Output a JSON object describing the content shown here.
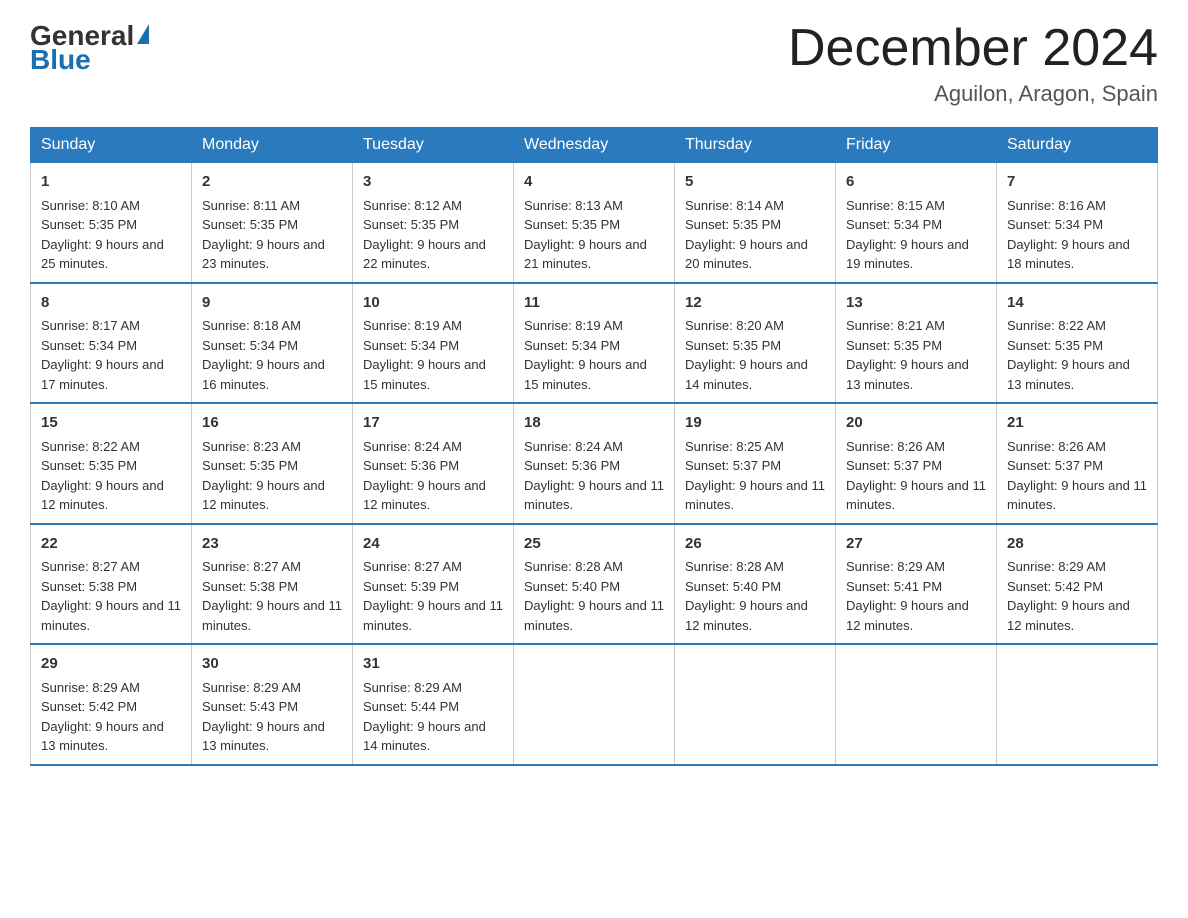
{
  "header": {
    "logo_general": "General",
    "logo_blue": "Blue",
    "month_title": "December 2024",
    "location": "Aguilon, Aragon, Spain"
  },
  "weekdays": [
    "Sunday",
    "Monday",
    "Tuesday",
    "Wednesday",
    "Thursday",
    "Friday",
    "Saturday"
  ],
  "weeks": [
    [
      {
        "day": "1",
        "sunrise": "8:10 AM",
        "sunset": "5:35 PM",
        "daylight": "9 hours and 25 minutes."
      },
      {
        "day": "2",
        "sunrise": "8:11 AM",
        "sunset": "5:35 PM",
        "daylight": "9 hours and 23 minutes."
      },
      {
        "day": "3",
        "sunrise": "8:12 AM",
        "sunset": "5:35 PM",
        "daylight": "9 hours and 22 minutes."
      },
      {
        "day": "4",
        "sunrise": "8:13 AM",
        "sunset": "5:35 PM",
        "daylight": "9 hours and 21 minutes."
      },
      {
        "day": "5",
        "sunrise": "8:14 AM",
        "sunset": "5:35 PM",
        "daylight": "9 hours and 20 minutes."
      },
      {
        "day": "6",
        "sunrise": "8:15 AM",
        "sunset": "5:34 PM",
        "daylight": "9 hours and 19 minutes."
      },
      {
        "day": "7",
        "sunrise": "8:16 AM",
        "sunset": "5:34 PM",
        "daylight": "9 hours and 18 minutes."
      }
    ],
    [
      {
        "day": "8",
        "sunrise": "8:17 AM",
        "sunset": "5:34 PM",
        "daylight": "9 hours and 17 minutes."
      },
      {
        "day": "9",
        "sunrise": "8:18 AM",
        "sunset": "5:34 PM",
        "daylight": "9 hours and 16 minutes."
      },
      {
        "day": "10",
        "sunrise": "8:19 AM",
        "sunset": "5:34 PM",
        "daylight": "9 hours and 15 minutes."
      },
      {
        "day": "11",
        "sunrise": "8:19 AM",
        "sunset": "5:34 PM",
        "daylight": "9 hours and 15 minutes."
      },
      {
        "day": "12",
        "sunrise": "8:20 AM",
        "sunset": "5:35 PM",
        "daylight": "9 hours and 14 minutes."
      },
      {
        "day": "13",
        "sunrise": "8:21 AM",
        "sunset": "5:35 PM",
        "daylight": "9 hours and 13 minutes."
      },
      {
        "day": "14",
        "sunrise": "8:22 AM",
        "sunset": "5:35 PM",
        "daylight": "9 hours and 13 minutes."
      }
    ],
    [
      {
        "day": "15",
        "sunrise": "8:22 AM",
        "sunset": "5:35 PM",
        "daylight": "9 hours and 12 minutes."
      },
      {
        "day": "16",
        "sunrise": "8:23 AM",
        "sunset": "5:35 PM",
        "daylight": "9 hours and 12 minutes."
      },
      {
        "day": "17",
        "sunrise": "8:24 AM",
        "sunset": "5:36 PM",
        "daylight": "9 hours and 12 minutes."
      },
      {
        "day": "18",
        "sunrise": "8:24 AM",
        "sunset": "5:36 PM",
        "daylight": "9 hours and 11 minutes."
      },
      {
        "day": "19",
        "sunrise": "8:25 AM",
        "sunset": "5:37 PM",
        "daylight": "9 hours and 11 minutes."
      },
      {
        "day": "20",
        "sunrise": "8:26 AM",
        "sunset": "5:37 PM",
        "daylight": "9 hours and 11 minutes."
      },
      {
        "day": "21",
        "sunrise": "8:26 AM",
        "sunset": "5:37 PM",
        "daylight": "9 hours and 11 minutes."
      }
    ],
    [
      {
        "day": "22",
        "sunrise": "8:27 AM",
        "sunset": "5:38 PM",
        "daylight": "9 hours and 11 minutes."
      },
      {
        "day": "23",
        "sunrise": "8:27 AM",
        "sunset": "5:38 PM",
        "daylight": "9 hours and 11 minutes."
      },
      {
        "day": "24",
        "sunrise": "8:27 AM",
        "sunset": "5:39 PM",
        "daylight": "9 hours and 11 minutes."
      },
      {
        "day": "25",
        "sunrise": "8:28 AM",
        "sunset": "5:40 PM",
        "daylight": "9 hours and 11 minutes."
      },
      {
        "day": "26",
        "sunrise": "8:28 AM",
        "sunset": "5:40 PM",
        "daylight": "9 hours and 12 minutes."
      },
      {
        "day": "27",
        "sunrise": "8:29 AM",
        "sunset": "5:41 PM",
        "daylight": "9 hours and 12 minutes."
      },
      {
        "day": "28",
        "sunrise": "8:29 AM",
        "sunset": "5:42 PM",
        "daylight": "9 hours and 12 minutes."
      }
    ],
    [
      {
        "day": "29",
        "sunrise": "8:29 AM",
        "sunset": "5:42 PM",
        "daylight": "9 hours and 13 minutes."
      },
      {
        "day": "30",
        "sunrise": "8:29 AM",
        "sunset": "5:43 PM",
        "daylight": "9 hours and 13 minutes."
      },
      {
        "day": "31",
        "sunrise": "8:29 AM",
        "sunset": "5:44 PM",
        "daylight": "9 hours and 14 minutes."
      },
      null,
      null,
      null,
      null
    ]
  ]
}
